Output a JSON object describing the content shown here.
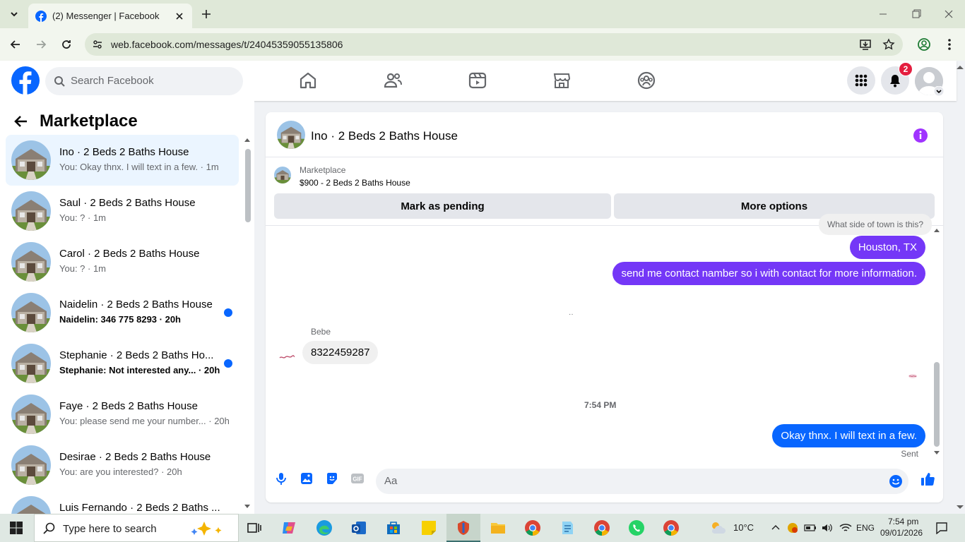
{
  "browser": {
    "tab_title": "(2) Messenger | Facebook",
    "url": "web.facebook.com/messages/t/24045359055135806"
  },
  "fb": {
    "search_placeholder": "Search Facebook",
    "notification_count": "2"
  },
  "sidebar": {
    "title": "Marketplace",
    "conversations": [
      {
        "name": "Ino · 2 Beds 2 Baths House",
        "preview": "You: Okay thnx. I will text in a few. · 1m",
        "active": true,
        "unread": false
      },
      {
        "name": "Saul · 2 Beds 2 Baths House",
        "preview": "You: ? · 1m",
        "active": false,
        "unread": false
      },
      {
        "name": "Carol · 2 Beds 2 Baths House",
        "preview": "You: ? · 1m",
        "active": false,
        "unread": false
      },
      {
        "name": "Naidelin · 2 Beds 2 Baths House",
        "preview": "Naidelin: 346 775 8293 · 20h",
        "active": false,
        "unread": true
      },
      {
        "name": "Stephanie · 2 Beds 2 Baths Ho...",
        "preview": "Stephanie: Not interested any... · 20h",
        "active": false,
        "unread": true
      },
      {
        "name": "Faye · 2 Beds 2 Baths House",
        "preview": "You: please send me your number... · 20h",
        "active": false,
        "unread": false
      },
      {
        "name": "Desirae · 2 Beds 2 Baths House",
        "preview": "You: are you interested? · 20h",
        "active": false,
        "unread": false
      },
      {
        "name": "Luis Fernando · 2 Beds 2 Baths ...",
        "preview": "",
        "active": false,
        "unread": false
      }
    ]
  },
  "chat": {
    "title": "Ino · 2 Beds 2 Baths House",
    "marketplace_label": "Marketplace",
    "listing": "$900 - 2 Beds 2 Baths House",
    "mark_pending": "Mark as pending",
    "more_options": "More options",
    "messages": {
      "cut_in": "What side of town is this?",
      "houston": "Houston, TX",
      "contact": "send me contact namber so i with contact  for more information.",
      "sender_name": "Bebe",
      "phone": "8322459287",
      "time": "7:54 PM",
      "okay": "Okay thnx. I will text in a few.",
      "status": "Sent"
    },
    "input_placeholder": "Aa"
  },
  "taskbar": {
    "search_placeholder": "Type here to search",
    "weather": "10°C",
    "lang": "ENG",
    "time": "7:54 pm",
    "date": "09/01/2026"
  }
}
